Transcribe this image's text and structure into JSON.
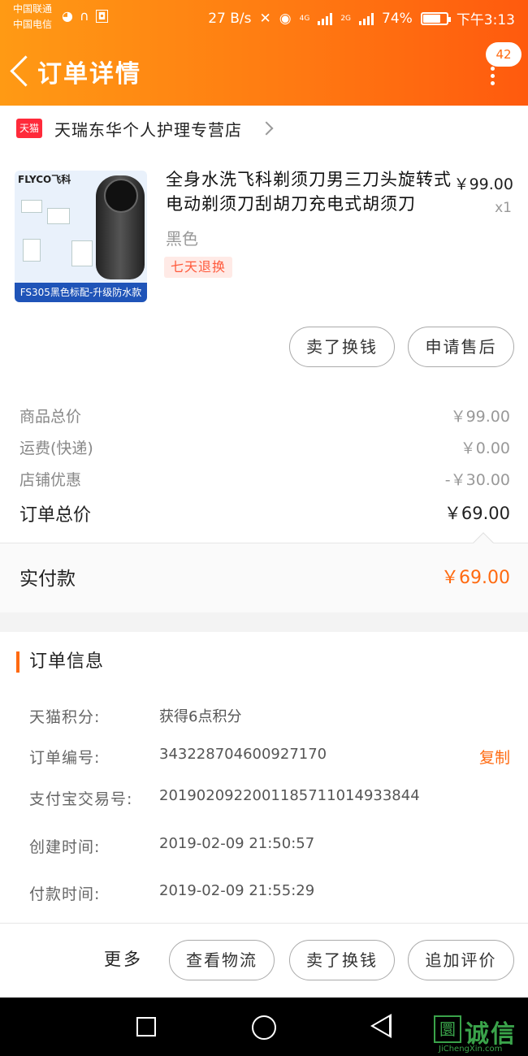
{
  "status_bar": {
    "carrier1": "中国联通",
    "carrier2": "中国电信",
    "speed": "27 B/s",
    "net1": "4G",
    "net2": "2G",
    "battery": "74%",
    "battery_level": 0.74,
    "time": "下午3:13"
  },
  "nav": {
    "title": "订单详情",
    "message_count": "42"
  },
  "shop": {
    "badge": "天猫",
    "name": "天瑞东华个人护理专营店"
  },
  "product": {
    "image_brand": "FLYCO飞科",
    "image_banner": "FS305黑色标配-升级防水款",
    "title": "全身水洗飞科剃须刀男三刀头旋转式电动剃须刀刮胡刀充电式胡须刀",
    "price": "￥99.00",
    "quantity": "x1",
    "sku": "黑色",
    "tag": "七天退换"
  },
  "item_buttons": {
    "sell": "卖了换钱",
    "after_sale": "申请售后"
  },
  "summary": {
    "goods_label": "商品总价",
    "goods_value": "￥99.00",
    "shipping_label": "运费(快递)",
    "shipping_value": "￥0.00",
    "discount_label": "店铺优惠",
    "discount_value": "-￥30.00",
    "total_label": "订单总价",
    "total_value": "￥69.00",
    "paid_label": "实付款",
    "paid_value": "￥69.00"
  },
  "order_info": {
    "title": "订单信息",
    "points_label": "天猫积分:",
    "points_value": "获得6点积分",
    "order_no_label": "订单编号:",
    "order_no_value": "343228704600927170",
    "copy_label": "复制",
    "alipay_label": "支付宝交易号:",
    "alipay_value": "2019020922001185711014933844",
    "created_label": "创建时间:",
    "created_value": "2019-02-09 21:50:57",
    "paid_time_label": "付款时间:",
    "paid_time_value": "2019-02-09 21:55:29"
  },
  "action_bar": {
    "more": "更多",
    "logistics": "查看物流",
    "sell": "卖了换钱",
    "review": "追加评价"
  },
  "watermark": {
    "icon": "圜",
    "text": "诚信",
    "sub": "JiChengXin.com"
  },
  "colors": {
    "accent": "#ff6a10",
    "tmall_red": "#ff2a3a"
  }
}
